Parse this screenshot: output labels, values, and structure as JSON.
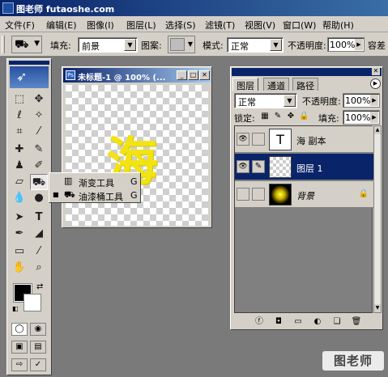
{
  "app": {
    "title": "图老师 futaoshe.com"
  },
  "menu": [
    "文件(F)",
    "编辑(E)",
    "图像(I)",
    "图层(L)",
    "选择(S)",
    "滤镜(T)",
    "视图(V)",
    "窗口(W)",
    "帮助(H)"
  ],
  "options": {
    "fill_label": "填充:",
    "fill_value": "前景",
    "pattern_label": "图案:",
    "mode_label": "模式:",
    "mode_value": "正常",
    "opacity_label": "不透明度:",
    "opacity_value": "100%",
    "tolerance_label": "容差"
  },
  "document": {
    "title": "未标题-1 @ 100% (...",
    "text_layer_content": "海"
  },
  "flyout": {
    "items": [
      {
        "label": "渐变工具",
        "shortcut": "G",
        "icon": "gradient-icon",
        "selected": false
      },
      {
        "label": "油漆桶工具",
        "shortcut": "G",
        "icon": "paint-bucket-icon",
        "selected": true
      }
    ]
  },
  "layers_panel": {
    "tabs": [
      "图层",
      "通道",
      "路径"
    ],
    "active_tab": "图层",
    "blend_mode": "正常",
    "opacity_label": "不透明度:",
    "opacity_value": "100%",
    "lock_label": "锁定:",
    "fill_label": "填充:",
    "fill_value": "100%",
    "layers": [
      {
        "name": "海 副本",
        "thumb": "T",
        "visible": true,
        "selected": false
      },
      {
        "name": "图层 1",
        "thumb": "",
        "visible": true,
        "selected": true
      },
      {
        "name": "背景",
        "thumb": "",
        "visible": false,
        "selected": false,
        "locked": true
      }
    ]
  },
  "colors": {
    "foreground": "#000000",
    "background": "#ffffff",
    "text_fill": "#f2e312",
    "selection": "#0a246a"
  },
  "watermark": "图老师"
}
